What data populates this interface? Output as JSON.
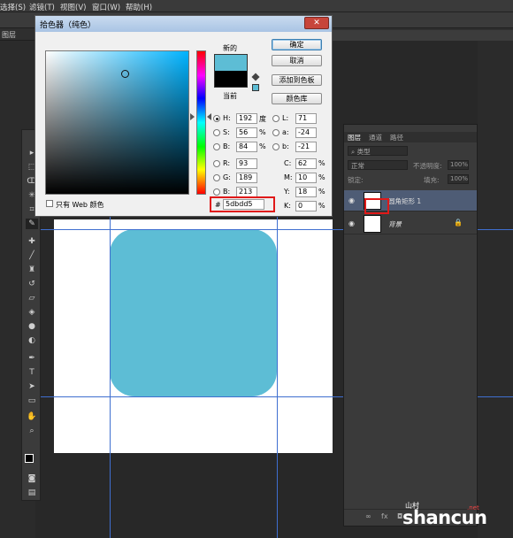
{
  "menubar": {
    "items": [
      "选择(S)",
      "滤镜(T)",
      "视图(V)",
      "窗口(W)",
      "帮助(H)"
    ]
  },
  "tab": {
    "label": "图层"
  },
  "dialog": {
    "title": "拾色器（纯色）",
    "new_label": "新的",
    "current_label": "当前",
    "new_color": "#5dbdd5",
    "current_color": "#000000",
    "buttons": {
      "ok": "确定",
      "cancel": "取消",
      "add_to_swatches": "添加到色板",
      "color_libraries": "颜色库"
    },
    "fields": {
      "H": {
        "label": "H:",
        "value": "192",
        "unit": "度"
      },
      "S": {
        "label": "S:",
        "value": "56",
        "unit": "%"
      },
      "B": {
        "label": "B:",
        "value": "84",
        "unit": "%"
      },
      "R": {
        "label": "R:",
        "value": "93"
      },
      "G": {
        "label": "G:",
        "value": "189"
      },
      "Bb": {
        "label": "B:",
        "value": "213"
      },
      "L": {
        "label": "L:",
        "value": "71"
      },
      "a": {
        "label": "a:",
        "value": "-24"
      },
      "b": {
        "label": "b:",
        "value": "-21"
      },
      "C": {
        "label": "C:",
        "value": "62",
        "unit": "%"
      },
      "M": {
        "label": "M:",
        "value": "10",
        "unit": "%"
      },
      "Y": {
        "label": "Y:",
        "value": "18",
        "unit": "%"
      },
      "K": {
        "label": "K:",
        "value": "0",
        "unit": "%"
      }
    },
    "hex_prefix": "#",
    "hex_value": "5dbdd5",
    "websafe_label": "只有 Web 颜色"
  },
  "layers_panel": {
    "tabs": [
      "图层",
      "通道",
      "路径"
    ],
    "filter_label": "类型",
    "blend_mode": "正常",
    "opacity_label": "不透明度:",
    "opacity_value": "100%",
    "lock_label": "锁定:",
    "fill_label": "填充:",
    "fill_value": "100%",
    "layers": [
      {
        "name": "圆角矩形 1"
      },
      {
        "name": "背景"
      }
    ]
  },
  "watermark": {
    "cn": "山村",
    "en": "shancun",
    "sub": ".net"
  }
}
